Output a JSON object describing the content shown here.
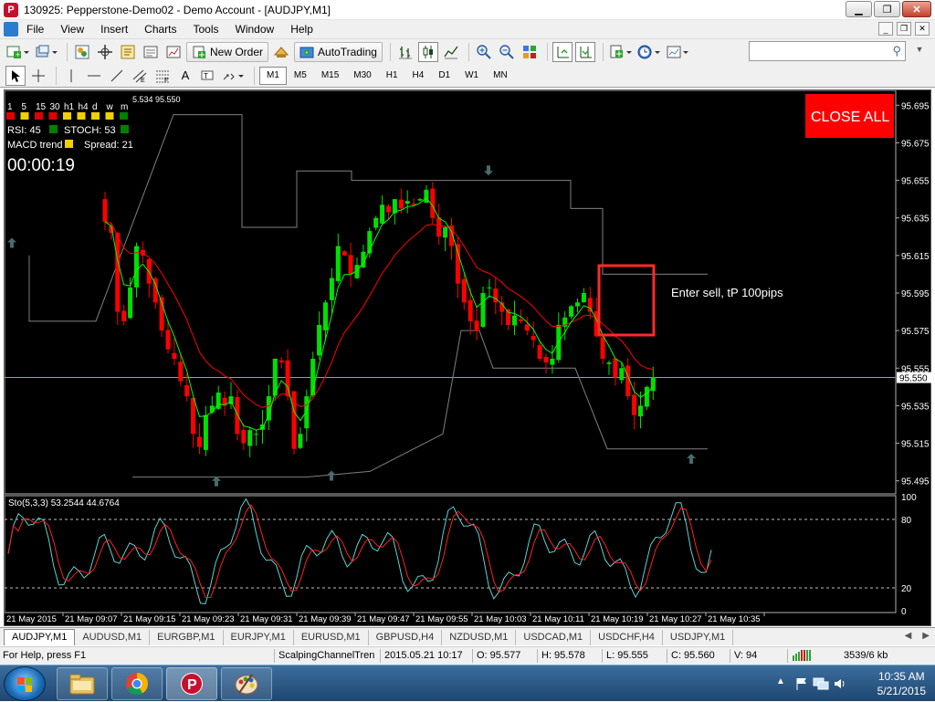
{
  "window": {
    "title": "130925: Pepperstone-Demo02 - Demo Account - [AUDJPY,M1]",
    "minimize": "▁",
    "restore": "❐",
    "close": "✕"
  },
  "menu": [
    "File",
    "View",
    "Insert",
    "Charts",
    "Tools",
    "Window",
    "Help"
  ],
  "toolbar": {
    "new_order": "New Order",
    "autotrading": "AutoTrading"
  },
  "timeframes": [
    "M1",
    "M5",
    "M15",
    "M30",
    "H1",
    "H4",
    "D1",
    "W1",
    "MN"
  ],
  "chart": {
    "symbol_overlay": "5.534 95.550",
    "tf_row": [
      "1",
      "5",
      "15",
      "30",
      "h1",
      "h4",
      "d",
      "w",
      "m"
    ],
    "rsi_label": "RSI: 45",
    "stoch_label": "STOCH: 53",
    "macd_label": "MACD trend",
    "spread_label": "Spread: 21",
    "timer": "00:00:19",
    "close_all": "CLOSE ALL",
    "annotation": "Enter sell, tP 100pips",
    "current_price": "95.550",
    "price_ticks": [
      "95.695",
      "95.675",
      "95.655",
      "95.635",
      "95.615",
      "95.595",
      "95.575",
      "95.555",
      "95.535",
      "95.515",
      "95.495"
    ],
    "time_ticks": [
      "21 May 2015",
      "21 May 09:07",
      "21 May 09:15",
      "21 May 09:23",
      "21 May 09:31",
      "21 May 09:39",
      "21 May 09:47",
      "21 May 09:55",
      "21 May 10:03",
      "21 May 10:11",
      "21 May 10:19",
      "21 May 10:27",
      "21 May 10:35"
    ],
    "stoch_label_text": "Sto(5,3,3) 53.2544 44.6764",
    "stoch_ticks": [
      "100",
      "80",
      "20",
      "0"
    ],
    "colors": {
      "bull": "#00e000",
      "bear": "#ff0000",
      "fast_ma": "#00ff00",
      "slow_ma": "#ff0000",
      "band": "#808080",
      "stoch_main": "#5fd0d0",
      "stoch_signal": "#ff2020"
    }
  },
  "chart_data": {
    "type": "candlestick",
    "x": [
      "09:01",
      "09:02",
      "09:03",
      "09:04",
      "09:05",
      "09:06",
      "09:07",
      "09:08",
      "09:09",
      "09:10",
      "09:11",
      "09:12",
      "09:13",
      "09:14",
      "09:15",
      "09:16",
      "09:17",
      "09:18",
      "09:19",
      "09:20",
      "09:21",
      "09:22",
      "09:23",
      "09:24",
      "09:25",
      "09:26",
      "09:27",
      "09:28",
      "09:29",
      "09:30",
      "09:31",
      "09:32",
      "09:33",
      "09:34",
      "09:35",
      "09:36",
      "09:37",
      "09:38",
      "09:39",
      "09:40",
      "09:41",
      "09:42",
      "09:43",
      "09:44",
      "09:45",
      "09:46",
      "09:47",
      "09:48",
      "09:49",
      "09:50",
      "09:51",
      "09:52",
      "09:53",
      "09:54",
      "09:55",
      "09:56",
      "09:57",
      "09:58",
      "09:59",
      "10:00",
      "10:01",
      "10:02",
      "10:03",
      "10:04",
      "10:05",
      "10:06",
      "10:07",
      "10:08",
      "10:09",
      "10:10",
      "10:11",
      "10:12",
      "10:13",
      "10:14",
      "10:15",
      "10:16",
      "10:17",
      "10:18",
      "10:19",
      "10:20",
      "10:21",
      "10:22",
      "10:23",
      "10:24",
      "10:25",
      "10:26",
      "10:27",
      "10:28",
      "10:29",
      "10:30",
      "10:31",
      "10:32",
      "10:33",
      "10:34",
      "10:35"
    ],
    "close": [
      95.633,
      95.627,
      95.585,
      95.58,
      95.598,
      95.62,
      95.615,
      95.6,
      95.59,
      95.575,
      95.565,
      95.56,
      95.548,
      95.54,
      95.52,
      95.513,
      95.53,
      95.535,
      95.542,
      95.535,
      95.54,
      95.52,
      95.515,
      95.522,
      95.52,
      95.525,
      95.54,
      95.56,
      95.558,
      95.54,
      95.512,
      95.52,
      95.54,
      95.56,
      95.578,
      95.59,
      95.603,
      95.62,
      95.615,
      95.605,
      95.61,
      95.617,
      95.628,
      95.635,
      95.642,
      95.638,
      95.645,
      95.64,
      95.644,
      95.642,
      95.645,
      95.65,
      95.635,
      95.625,
      95.63,
      95.62,
      95.6,
      95.59,
      95.58,
      95.575,
      95.595,
      95.598,
      95.59,
      95.585,
      95.578,
      95.583,
      95.58,
      95.575,
      95.57,
      95.56,
      95.558,
      95.56,
      95.578,
      95.582,
      95.588,
      95.59,
      95.595,
      95.585,
      95.572,
      95.56,
      95.558,
      95.55,
      95.555,
      95.54,
      95.53,
      95.535,
      95.545,
      95.55
    ],
    "high_low_range": [
      95.495,
      95.695
    ],
    "band_upper_level": 95.655,
    "band_lower_level": 95.51,
    "stochastic": {
      "main_last": 53.2544,
      "signal_last": 44.6764,
      "levels": [
        80,
        20
      ],
      "ylim": [
        0,
        100
      ]
    },
    "ylim": [
      95.49,
      95.7
    ]
  },
  "tabs": [
    "AUDJPY,M1",
    "AUDUSD,M1",
    "EURGBP,M1",
    "EURJPY,M1",
    "EURUSD,M1",
    "GBPUSD,H4",
    "NZDUSD,M1",
    "USDCAD,M1",
    "USDCHF,H4",
    "USDJPY,M1"
  ],
  "status": {
    "help": "For Help, press F1",
    "profile": "ScalpingChannelTren",
    "datetime": "2015.05.21 10:17",
    "open": "O: 95.577",
    "high": "H: 95.578",
    "low": "L: 95.555",
    "close": "C: 95.560",
    "volume": "V: 94",
    "traffic": "3539/6 kb"
  },
  "taskbar": {
    "time": "10:35 AM",
    "date": "5/21/2015"
  }
}
